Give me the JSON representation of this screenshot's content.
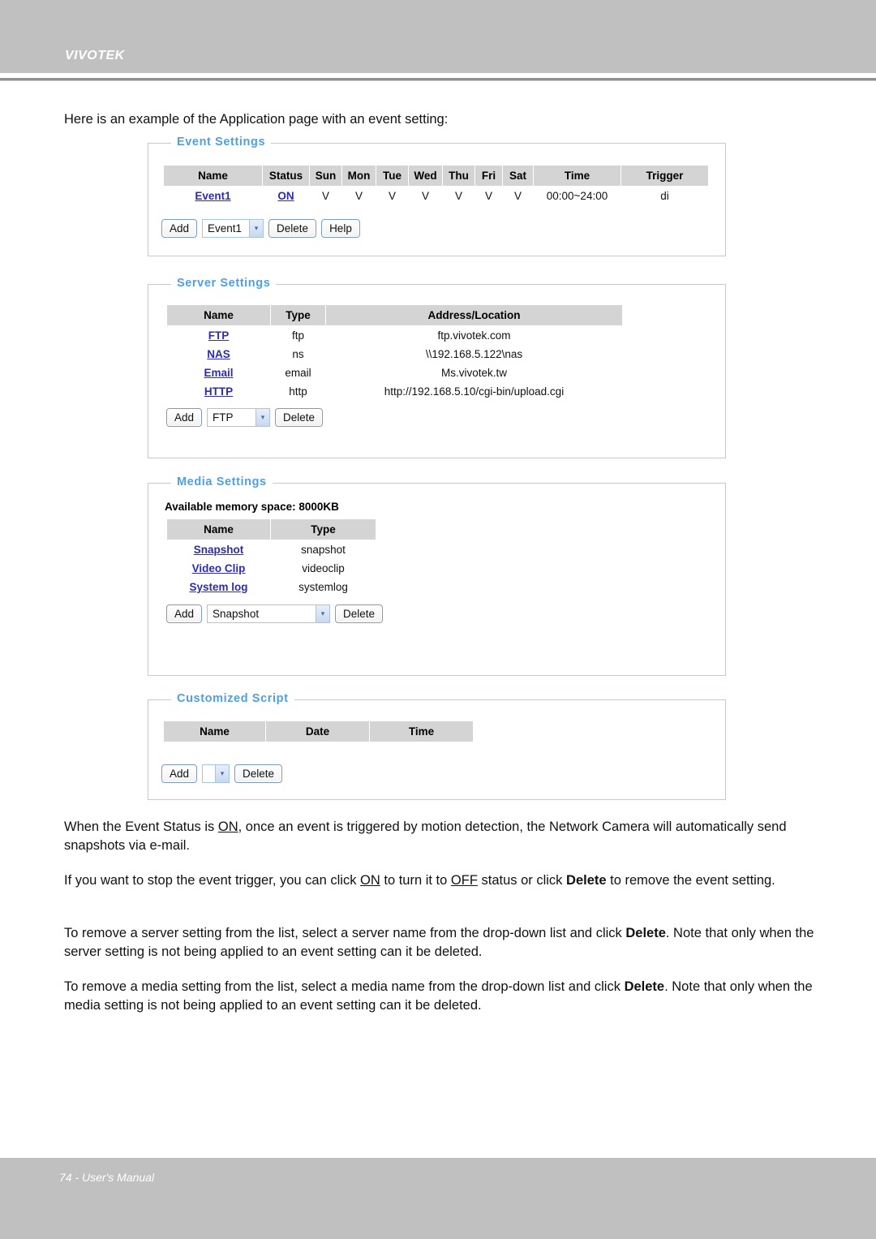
{
  "header": {
    "brand": "VIVOTEK"
  },
  "intro": "Here is an example of the Application page with an event setting:",
  "event_settings": {
    "legend": "Event Settings",
    "columns": [
      "Name",
      "Status",
      "Sun",
      "Mon",
      "Tue",
      "Wed",
      "Thu",
      "Fri",
      "Sat",
      "Time",
      "Trigger"
    ],
    "rows": [
      {
        "name": "Event1",
        "status": "ON",
        "sun": "V",
        "mon": "V",
        "tue": "V",
        "wed": "V",
        "thu": "V",
        "fri": "V",
        "sat": "V",
        "time": "00:00~24:00",
        "trigger": "di"
      }
    ],
    "controls": {
      "add_label": "Add",
      "select_value": "Event1",
      "delete_label": "Delete",
      "help_label": "Help"
    }
  },
  "server_settings": {
    "legend": "Server Settings",
    "columns": [
      "Name",
      "Type",
      "Address/Location"
    ],
    "rows": [
      {
        "name": "FTP",
        "type": "ftp",
        "address": "ftp.vivotek.com"
      },
      {
        "name": "NAS",
        "type": "ns",
        "address": "\\\\192.168.5.122\\nas"
      },
      {
        "name": "Email",
        "type": "email",
        "address": "Ms.vivotek.tw"
      },
      {
        "name": "HTTP",
        "type": "http",
        "address": "http://192.168.5.10/cgi-bin/upload.cgi"
      }
    ],
    "controls": {
      "add_label": "Add",
      "select_value": "FTP",
      "delete_label": "Delete"
    }
  },
  "media_settings": {
    "legend": "Media Settings",
    "memory_line": "Available memory space: 8000KB",
    "columns": [
      "Name",
      "Type"
    ],
    "rows": [
      {
        "name": "Snapshot",
        "type": "snapshot"
      },
      {
        "name": "Video Clip",
        "type": "videoclip"
      },
      {
        "name": "System log",
        "type": "systemlog"
      }
    ],
    "controls": {
      "add_label": "Add",
      "select_value": "Snapshot",
      "delete_label": "Delete"
    }
  },
  "customized_script": {
    "legend": "Customized Script",
    "columns": [
      "Name",
      "Date",
      "Time"
    ],
    "rows": [],
    "controls": {
      "add_label": "Add",
      "select_value": "",
      "delete_label": "Delete"
    }
  },
  "paragraphs": {
    "p1_a": "When the Event Status is ",
    "p1_on": "ON",
    "p1_b": ", once an event is triggered by motion detection, the Network Camera will automatically send snapshots via e-mail.",
    "p2_a": "If you want to stop the event trigger, you can click ",
    "p2_on": "ON",
    "p2_b": " to turn it to ",
    "p2_off": "OFF",
    "p2_c": " status or click ",
    "p2_delete": "Delete",
    "p2_d": " to remove the event setting.",
    "p3_a": "To remove a server setting from the list, select a server name from the drop-down list and click ",
    "p3_delete": "Delete",
    "p3_b": ". Note that only when the server setting is not being applied to an event setting can it be deleted.",
    "p4_a": "To remove a media setting from the list, select a media name from the drop-down list and click ",
    "p4_delete": "Delete",
    "p4_b": ". Note that only when the media setting is not being applied to an event setting can it be deleted."
  },
  "footer": {
    "text": "74 - User's Manual"
  },
  "icons": {
    "chevron_down": "▾"
  },
  "colors": {
    "legend_blue": "#4f9fe8",
    "link_blue": "#2b2bb5",
    "header_gray": "#c0c0c0",
    "table_header_gray": "#d4d4d4"
  }
}
